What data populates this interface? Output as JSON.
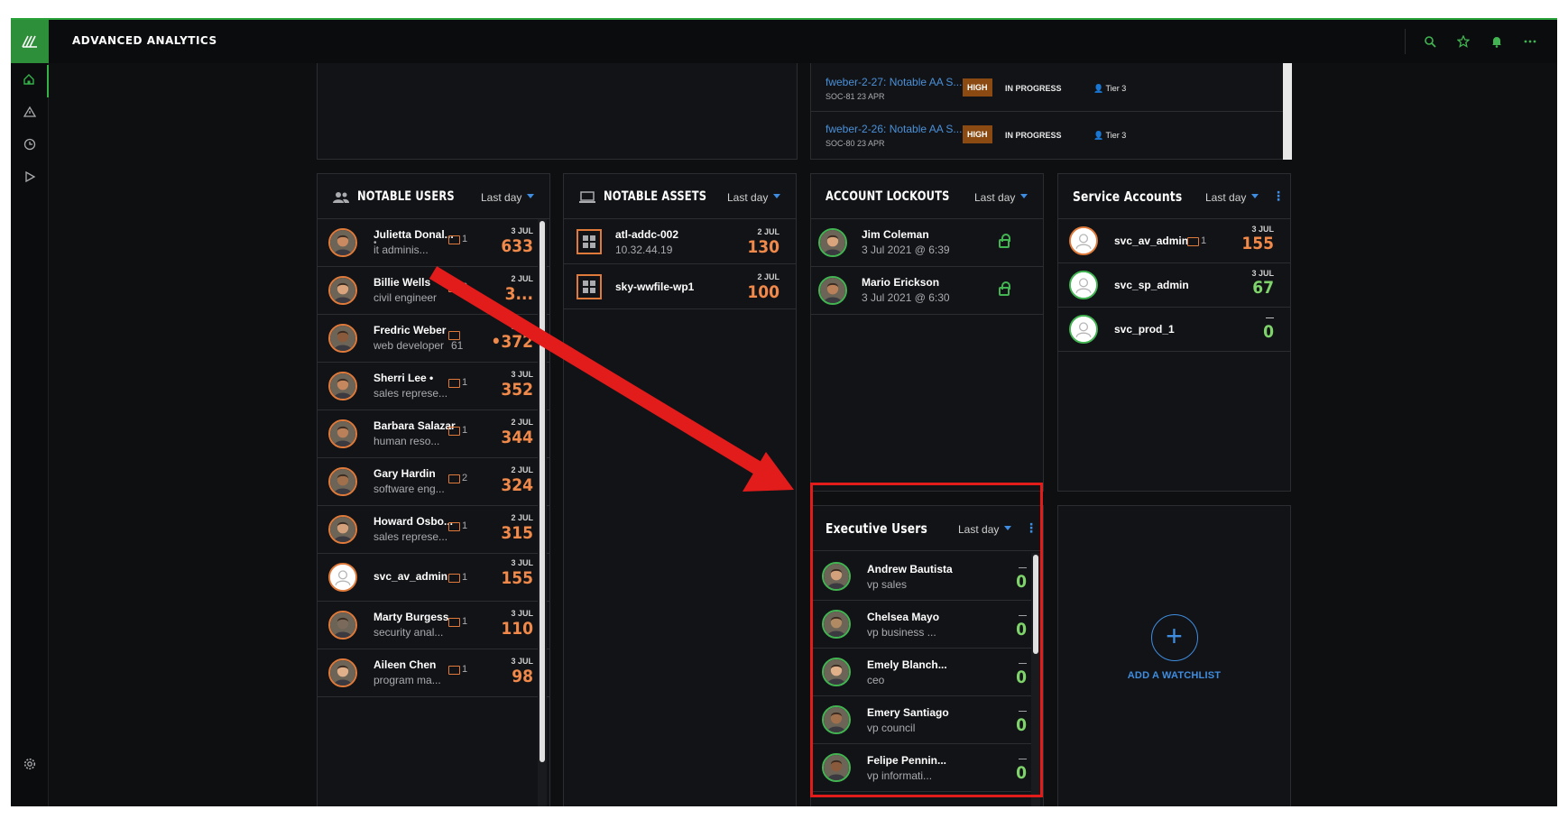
{
  "app": {
    "title": "ADVANCED ANALYTICS"
  },
  "icons": {
    "logo": "logo-icon",
    "home": "home-icon",
    "alerts": "warning-icon",
    "history": "clock-icon",
    "play": "play-icon",
    "settings": "gear-icon",
    "search": "search-icon",
    "star": "star-icon",
    "bell": "bell-icon",
    "more": "more-icon"
  },
  "colors": {
    "accent_green": "#42b552",
    "accent_orange": "#f0894a",
    "accent_blue": "#3f8de0",
    "highlight_red": "#e21b1b"
  },
  "tickets": [
    {
      "name": "fweber-2-27: Notable AA S...",
      "sub": "SOC-81  23 APR",
      "priority": "HIGH",
      "status": "IN PROGRESS",
      "tier": "Tier 3"
    },
    {
      "name": "fweber-2-26: Notable AA S...",
      "sub": "SOC-80  23 APR",
      "priority": "HIGH",
      "status": "IN PROGRESS",
      "tier": "Tier 3"
    }
  ],
  "notable_users": {
    "title": "NOTABLE USERS",
    "range": "Last day",
    "rows": [
      {
        "name": "Julietta Donal...",
        "extra": "•",
        "sub": "it adminis...",
        "folder": "1",
        "date": "3 JUL",
        "score": "633"
      },
      {
        "name": "Billie Wells",
        "sub": "civil engineer",
        "folder": "2",
        "date": "2 JUL",
        "score": "3..."
      },
      {
        "name": "Fredric Weber",
        "sub": "web developer",
        "folder": "",
        "extra": "61",
        "date": "3 JUL",
        "score": "•372"
      },
      {
        "name": "Sherri Lee •",
        "sub": "sales represe...",
        "folder": "1",
        "date": "3 JUL",
        "score": "352"
      },
      {
        "name": "Barbara Salazar",
        "sub": "human reso...",
        "folder": "1",
        "date": "2 JUL",
        "score": "344"
      },
      {
        "name": "Gary Hardin",
        "sub": "software eng...",
        "folder": "2",
        "date": "2 JUL",
        "score": "324"
      },
      {
        "name": "Howard Osbo...",
        "sub": "sales represe...",
        "folder": "1",
        "date": "2 JUL",
        "score": "315"
      },
      {
        "name": "svc_av_admin",
        "sub": "",
        "folder": "1",
        "date": "3 JUL",
        "score": "155"
      },
      {
        "name": "Marty Burgess",
        "sub": "security anal...",
        "folder": "1",
        "date": "3 JUL",
        "score": "110"
      },
      {
        "name": "Aileen Chen",
        "sub": "program ma...",
        "folder": "1",
        "date": "3 JUL",
        "score": "98"
      }
    ]
  },
  "notable_assets": {
    "title": "NOTABLE ASSETS",
    "range": "Last day",
    "rows": [
      {
        "name": "atl-addc-002",
        "sub": "10.32.44.19",
        "date": "2 JUL",
        "score": "130"
      },
      {
        "name": "sky-wwfile-wp1",
        "sub": "",
        "date": "2 JUL",
        "score": "100"
      }
    ]
  },
  "account_lockouts": {
    "title": "ACCOUNT LOCKOUTS",
    "range": "Last day",
    "rows": [
      {
        "name": "Jim Coleman",
        "sub": "3 Jul 2021 @ 6:39"
      },
      {
        "name": "Mario Erickson",
        "sub": "3 Jul 2021 @ 6:30"
      }
    ]
  },
  "service_accounts": {
    "title": "Service Accounts",
    "range": "Last day",
    "rows": [
      {
        "name": "svc_av_admin",
        "folder": "1",
        "date": "3 JUL",
        "score": "155"
      },
      {
        "name": "svc_sp_admin",
        "folder": "",
        "date": "3 JUL",
        "score": "67"
      },
      {
        "name": "svc_prod_1",
        "folder": "",
        "date": "—",
        "score": "0"
      }
    ]
  },
  "executive_users": {
    "title": "Executive Users",
    "range": "Last day",
    "rows": [
      {
        "name": "Andrew Bautista",
        "sub": "vp sales",
        "date": "—",
        "score": "0"
      },
      {
        "name": "Chelsea Mayo",
        "sub": "vp business ...",
        "date": "—",
        "score": "0"
      },
      {
        "name": "Emely Blanch...",
        "sub": "ceo",
        "date": "—",
        "score": "0"
      },
      {
        "name": "Emery Santiago",
        "sub": "vp council",
        "date": "—",
        "score": "0"
      },
      {
        "name": "Felipe Pennin...",
        "sub": "vp informati...",
        "date": "—",
        "score": "0"
      }
    ]
  },
  "add_watchlist": {
    "label": "ADD A WATCHLIST",
    "plus": "+"
  }
}
